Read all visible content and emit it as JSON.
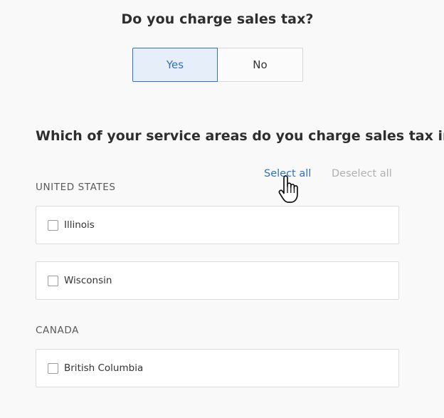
{
  "sales_tax_question": "Do you charge sales tax?",
  "sales_tax_toggle": {
    "yes_label": "Yes",
    "no_label": "No",
    "selected": "Yes"
  },
  "service_area_question": "Which of your service areas do you charge sales tax in?",
  "actions": {
    "select_all": "Select all",
    "deselect_all": "Deselect all"
  },
  "regions": [
    {
      "name": "UNITED STATES",
      "areas": [
        {
          "label": "Illinois",
          "checked": false
        },
        {
          "label": "Wisconsin",
          "checked": false
        }
      ]
    },
    {
      "name": "CANADA",
      "areas": [
        {
          "label": "British Columbia",
          "checked": false
        }
      ]
    }
  ],
  "colors": {
    "accent": "#2f6fc9",
    "selected_bg": "#e6eef9",
    "disabled_text": "#b0b0b0",
    "page_bg": "#f9f9f9"
  },
  "cursor_icon": "hand-pointer-icon"
}
